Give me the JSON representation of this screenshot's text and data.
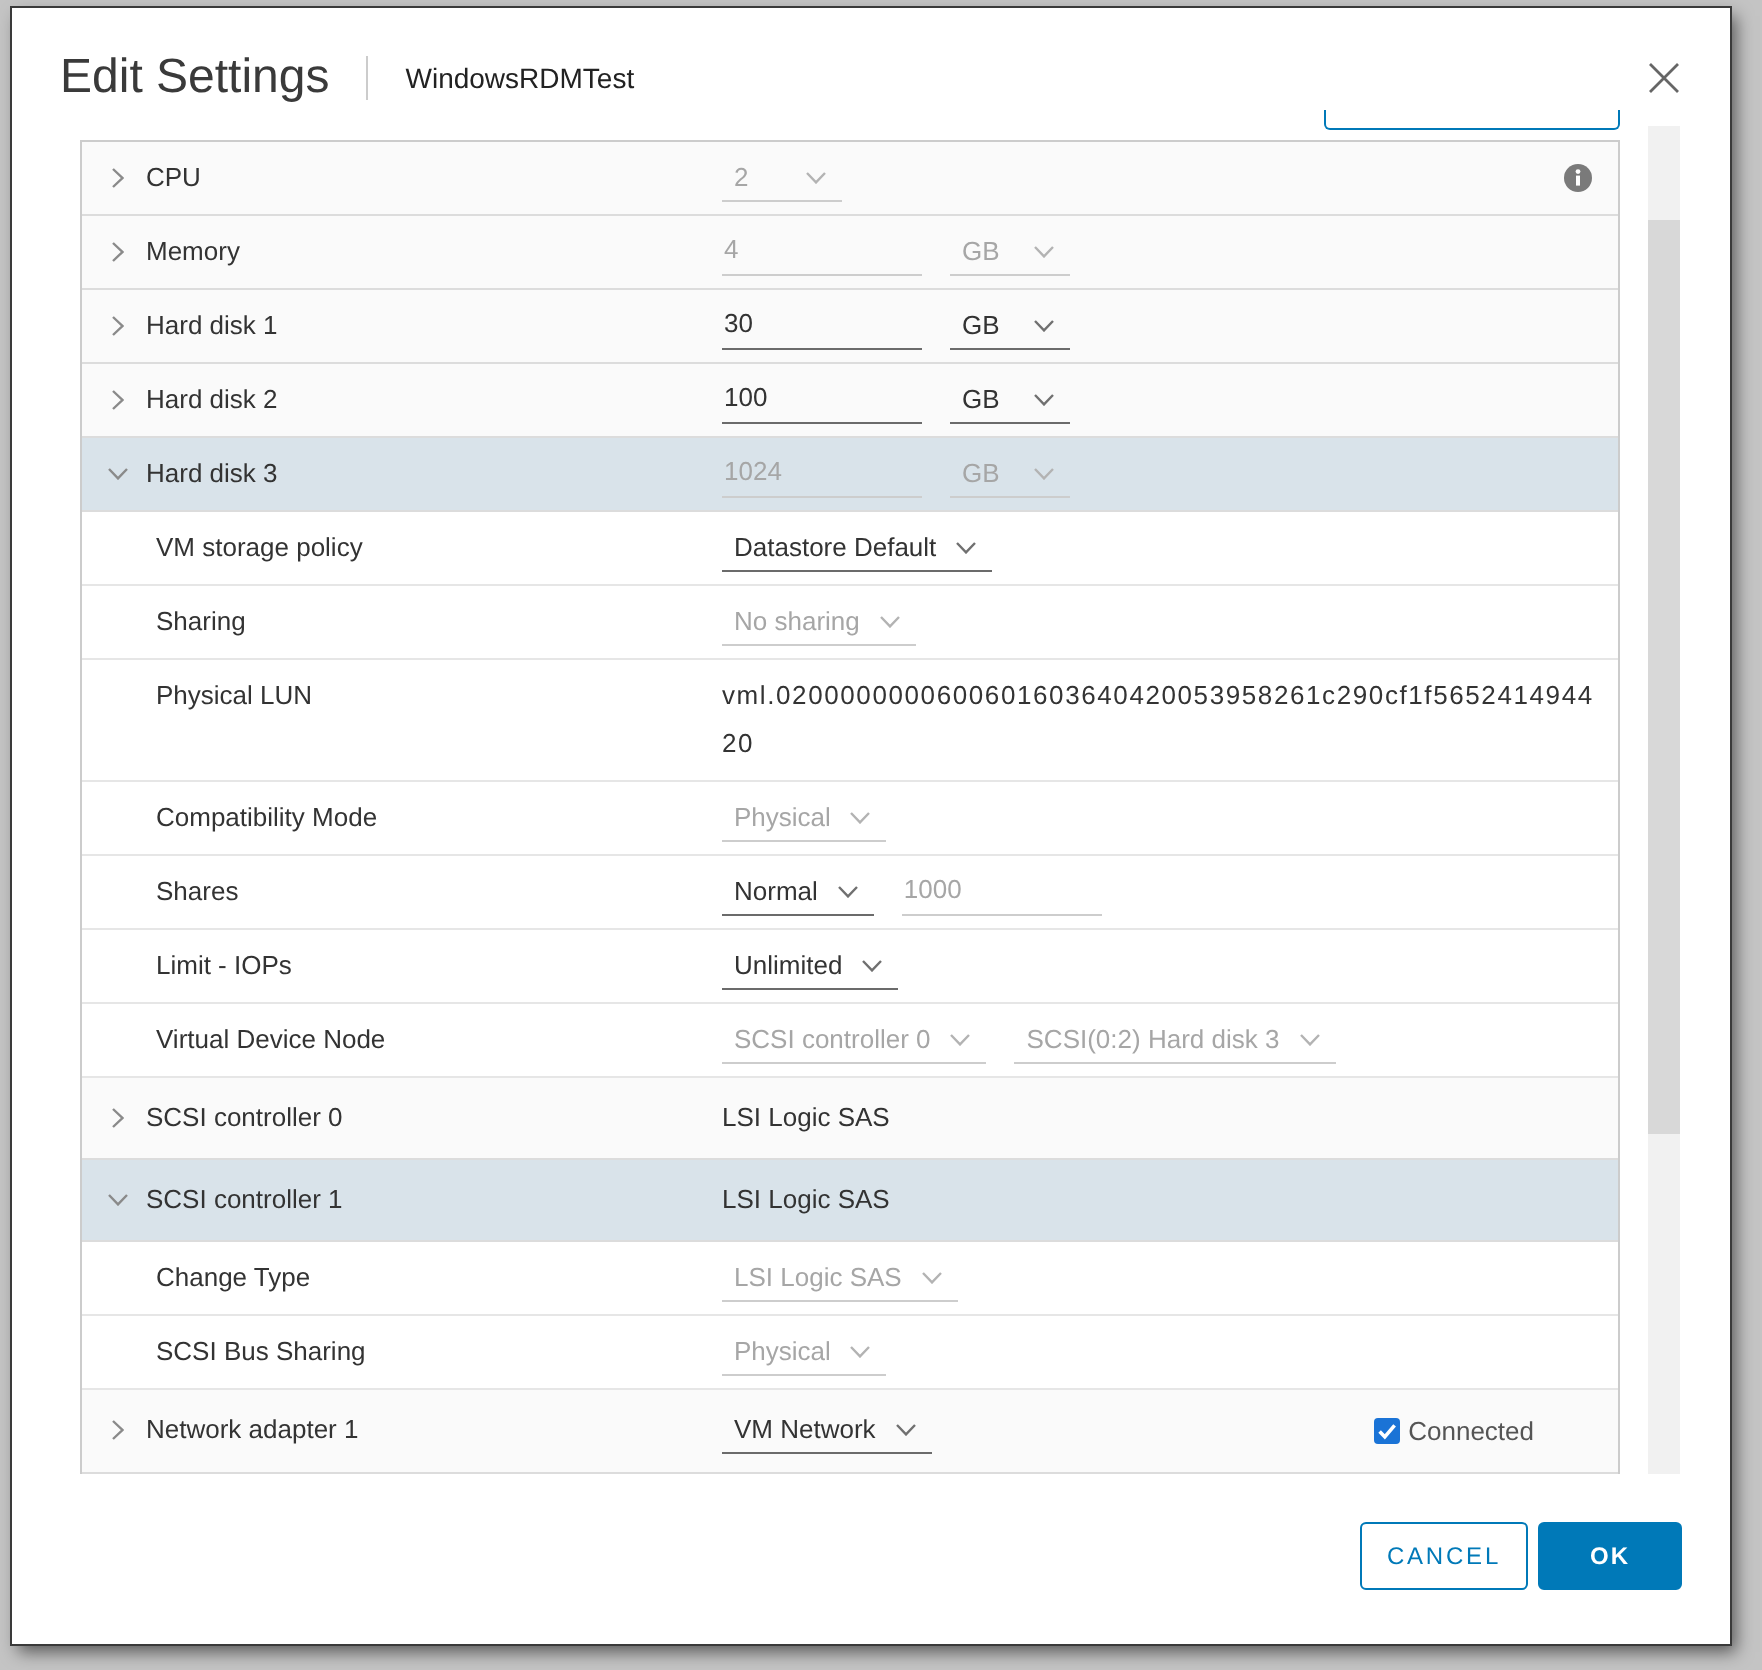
{
  "dialog": {
    "title": "Edit Settings",
    "subtitle": "WindowsRDMTest"
  },
  "devices": [
    {
      "label": "CPU",
      "expanded": false,
      "info": true,
      "controls": [
        {
          "kind": "select",
          "value": "2",
          "disabled": true
        }
      ]
    },
    {
      "label": "Memory",
      "expanded": false,
      "info": false,
      "controls": [
        {
          "kind": "input",
          "value": "4",
          "disabled": true
        },
        {
          "kind": "select",
          "value": "GB",
          "disabled": true
        }
      ]
    },
    {
      "label": "Hard disk 1",
      "expanded": false,
      "info": false,
      "controls": [
        {
          "kind": "input",
          "value": "30",
          "disabled": false
        },
        {
          "kind": "select",
          "value": "GB",
          "disabled": false
        }
      ]
    },
    {
      "label": "Hard disk 2",
      "expanded": false,
      "info": false,
      "controls": [
        {
          "kind": "input",
          "value": "100",
          "disabled": false
        },
        {
          "kind": "select",
          "value": "GB",
          "disabled": false
        }
      ]
    },
    {
      "label": "Hard disk 3",
      "expanded": true,
      "info": false,
      "controls": [
        {
          "kind": "input",
          "value": "1024",
          "disabled": true
        },
        {
          "kind": "select",
          "value": "GB",
          "disabled": true
        }
      ],
      "children": [
        {
          "label": "VM storage policy",
          "controls": [
            {
              "kind": "select",
              "value": "Datastore Default",
              "disabled": false
            }
          ]
        },
        {
          "label": "Sharing",
          "controls": [
            {
              "kind": "select",
              "value": "No sharing",
              "disabled": true
            }
          ]
        },
        {
          "label": "Physical LUN",
          "controls": [
            {
              "kind": "text",
              "value": "vml.0200000000600601603640420053958261c290cf1f565241494420"
            }
          ]
        },
        {
          "label": "Compatibility Mode",
          "controls": [
            {
              "kind": "select",
              "value": "Physical",
              "disabled": true
            }
          ]
        },
        {
          "label": "Shares",
          "controls": [
            {
              "kind": "select",
              "value": "Normal",
              "disabled": false
            },
            {
              "kind": "input",
              "value": "1000",
              "disabled": true
            }
          ]
        },
        {
          "label": "Limit - IOPs",
          "controls": [
            {
              "kind": "select",
              "value": "Unlimited",
              "disabled": false
            }
          ]
        },
        {
          "label": "Virtual Device Node",
          "controls": [
            {
              "kind": "select",
              "value": "SCSI controller 0",
              "disabled": true
            },
            {
              "kind": "select",
              "value": "SCSI(0:2) Hard disk 3",
              "disabled": true
            }
          ]
        }
      ]
    },
    {
      "label": "SCSI controller 0",
      "expanded": false,
      "info": false,
      "controls": [
        {
          "kind": "text",
          "value": "LSI Logic SAS"
        }
      ]
    },
    {
      "label": "SCSI controller 1",
      "expanded": true,
      "info": false,
      "controls": [
        {
          "kind": "text",
          "value": "LSI Logic SAS"
        }
      ],
      "children": [
        {
          "label": "Change Type",
          "controls": [
            {
              "kind": "select",
              "value": "LSI Logic SAS",
              "disabled": true
            }
          ]
        },
        {
          "label": "SCSI Bus Sharing",
          "controls": [
            {
              "kind": "select",
              "value": "Physical",
              "disabled": true
            }
          ]
        }
      ]
    },
    {
      "label": "Network adapter 1",
      "expanded": false,
      "info": false,
      "controls": [
        {
          "kind": "select",
          "value": "VM Network",
          "disabled": false
        },
        {
          "kind": "checkbox",
          "label": "Connected",
          "checked": true
        }
      ]
    }
  ],
  "buttons": [
    {
      "label": "CANCEL",
      "kind": "cancel"
    },
    {
      "label": "OK",
      "kind": "confirm"
    }
  ]
}
